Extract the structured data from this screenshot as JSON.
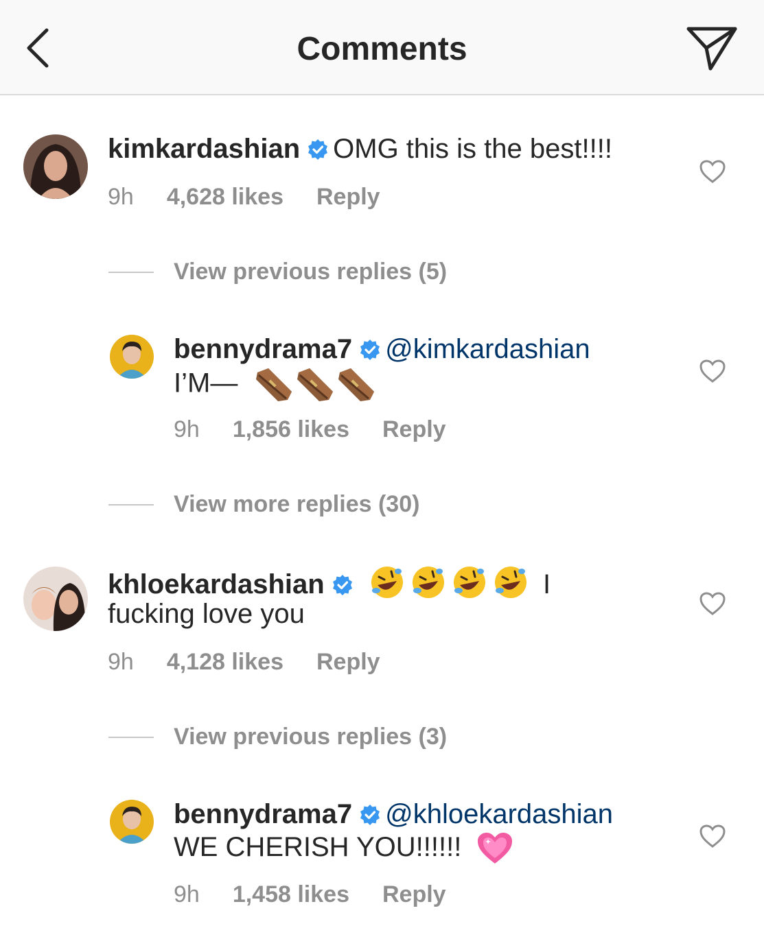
{
  "header": {
    "title": "Comments"
  },
  "comments": [
    {
      "username": "kimkardashian",
      "text": "OMG this is the best!!!!",
      "time": "9h",
      "likes": "4,628 likes",
      "reply": "Reply"
    },
    {
      "username": "bennydrama7",
      "mention": "@kimkardashian",
      "text": "I’M—",
      "emoji": "coffin-emoji",
      "time": "9h",
      "likes": "1,856 likes",
      "reply": "Reply"
    },
    {
      "username": "khloekardashian",
      "text_line1_end": "I",
      "text_line2": "fucking love you",
      "emoji": "rolling-on-floor-laughing-emoji",
      "time": "9h",
      "likes": "4,128 likes",
      "reply": "Reply"
    },
    {
      "username": "bennydrama7",
      "mention": "@khloekardashian",
      "text": "WE CHERISH YOU!!!!!!",
      "emoji": "sparkling-heart-emoji",
      "time": "9h",
      "likes": "1,458 likes",
      "reply": "Reply"
    }
  ],
  "view_replies": [
    "View previous replies (5)",
    "View more replies (30)",
    "View previous replies (3)"
  ],
  "colors": {
    "verified_blue": "#3897f0",
    "mention": "#003569",
    "meta_gray": "#8e8e8e",
    "header_bg": "#f9f9f9"
  },
  "icons": {
    "back": "chevron-left-icon",
    "send": "paper-plane-icon",
    "like": "heart-outline-icon",
    "verified": "verified-badge-icon"
  }
}
